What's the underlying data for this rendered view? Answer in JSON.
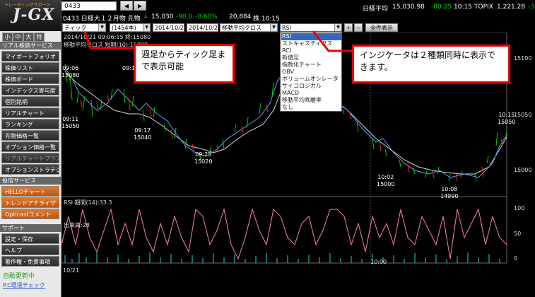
{
  "logo": {
    "sub": "トレーディングサポート",
    "name": "J-GX"
  },
  "sidebar": {
    "sizes": [
      "小",
      "中",
      "大",
      "特"
    ],
    "section1": "リアル株価サービス",
    "items1": [
      "マイポートフォリオ",
      "株価リスト",
      "株価ボード",
      "インデックス寄与度",
      "個別銘柄",
      "リアルチャート",
      "ランキング",
      "先物価格一覧",
      "オプション価格一覧",
      "リアルチャートプラス",
      "オプションストラテジ"
    ],
    "section2": "投信サービス",
    "items2": [
      "HELLOチャート",
      "トレンドアナライザ",
      "Opticastコメント"
    ],
    "section3": "サポート",
    "items3": [
      "設定・保存",
      "ヘルプ",
      "著作権・免責事項"
    ],
    "status": "自動更新中",
    "pc_check": "P.C環境チェック"
  },
  "header": {
    "code_value": "0433",
    "prev": "◀",
    "next": "▶",
    "instrument": "0433 日経大１２月物 先物",
    "arrow": "↓",
    "price": "15,030",
    "change": "-90.0",
    "change_pct": "-0.60%",
    "volume": "20,884",
    "time": "株 10:15",
    "nikkei_label": "日経平均",
    "nikkei_value": "15,030.98",
    "nikkei_change": "-80.25",
    "nikkei_time": "10:15",
    "topix_label": "TOPIX",
    "topix_value": "1,221.28",
    "topix_change": "-3"
  },
  "controls": {
    "type": "ティック",
    "count": "(1454本)",
    "date_from": "2014/10/21",
    "date_to": "2014/10/21",
    "indicator1": "移動平均クロス",
    "indicator2": "RSI",
    "zoom_in": "＋",
    "zoom_out": "－",
    "fullscreen": "全件表示"
  },
  "dropdown": {
    "options": [
      "RSI",
      "ストキャスティクス",
      "RCI",
      "新値足",
      "指数化チャート",
      "OBV",
      "ボリュームオシレータ",
      "サイコロジカル",
      "MACD",
      "移動平均乖離率",
      "なし"
    ],
    "selected": "RSI"
  },
  "chart": {
    "info_line": "2014/10/21 09:06:15 終:15080",
    "ma_line": "移動平均クロス 短期(10):15080",
    "y_labels": [
      "15100",
      "15050",
      "15000"
    ],
    "lows": [
      {
        "time": "09:06",
        "price": "15080"
      },
      {
        "time": "09:1",
        "price": ""
      },
      {
        "time": "09:11",
        "price": "15050"
      },
      {
        "time": "09:17",
        "price": "15040"
      },
      {
        "time": "09:25",
        "price": "15020"
      },
      {
        "time": "10:02",
        "price": "15000"
      },
      {
        "time": "10:08",
        "price": "14990"
      },
      {
        "time": "10:15",
        "price": "15050"
      }
    ],
    "rsi_label": "RSI 期間(14):33.3",
    "volume_label": "出来高:28",
    "rsi_ticks": [
      "100",
      "50",
      "0"
    ],
    "x_date": "10/21",
    "x_time": "10:00"
  },
  "callouts": {
    "left": "週足からティック足まで表示可能",
    "right": "インジケータは２種類同時に表示できます。"
  },
  "colors": {
    "up": "#00d000",
    "down": "#e83030",
    "ma_short": "#5aa0ff",
    "ma_long": "#ffffff",
    "rsi": "#ff80b0",
    "volume": "#30d0d0",
    "accent": "#e07a2a"
  }
}
